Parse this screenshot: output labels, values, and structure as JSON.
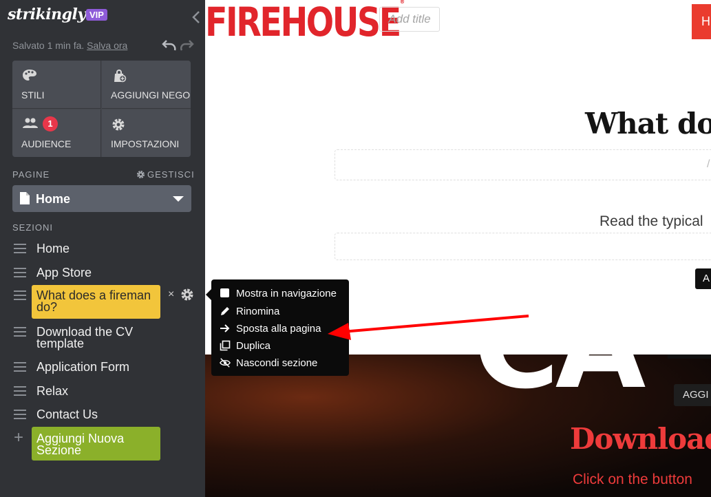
{
  "sidebar": {
    "logo": "strikingly",
    "vip_badge": "VIP",
    "save_status": "Salvato 1 min fa.",
    "save_now": "Salva ora",
    "tiles": [
      {
        "label": "STILI",
        "icon": "palette-icon"
      },
      {
        "label": "AGGIUNGI NEGO",
        "icon": "shopping-bag-icon"
      },
      {
        "label": "AUDIENCE",
        "icon": "people-icon",
        "badge": "1"
      },
      {
        "label": "IMPOSTAZIONI",
        "icon": "gear-icon"
      }
    ],
    "pages_label": "PAGINE",
    "manage_label": "GESTISCI",
    "current_page": "Home",
    "sections_label": "SEZIONI",
    "sections": [
      {
        "name": "Home"
      },
      {
        "name": "App Store"
      },
      {
        "name": "What does a fireman do?",
        "line1": "What does a fireman",
        "line2": "do?"
      },
      {
        "name": "Download the CV template",
        "line1": "Download the CV",
        "line2": "template"
      },
      {
        "name": "Application Form"
      },
      {
        "name": "Relax"
      },
      {
        "name": "Contact Us"
      }
    ],
    "add_section_line1": "Aggiungi Nuova",
    "add_section_line2": "Sezione",
    "remove_symbol": "×"
  },
  "context_menu": {
    "items": [
      {
        "label": "Mostra in navigazione",
        "icon": "checkbox-icon"
      },
      {
        "label": "Rinomina",
        "icon": "pencil-icon"
      },
      {
        "label": "Sposta alla pagina",
        "icon": "arrow-right-icon"
      },
      {
        "label": "Duplica",
        "icon": "duplicate-icon"
      },
      {
        "label": "Nascondi sezione",
        "icon": "eye-slash-icon"
      }
    ]
  },
  "canvas": {
    "brand": "FIREHOUSE",
    "add_title_placeholder": "Add title",
    "nav_button": "H",
    "heading": "What doe",
    "subtitle": "Read the typical",
    "black_button": "A",
    "big_letters": "CA",
    "aggi_button": "AGGI",
    "download_heading": "Download",
    "click_text": "Click on the button"
  },
  "colors": {
    "sidebar_bg": "#303236",
    "highlight_yellow": "#f2c53b",
    "highlight_green": "#8bb02a",
    "vip_purple": "#8e5bd8",
    "brand_red": "#e1252b",
    "annotation_red": "#ff0000"
  }
}
